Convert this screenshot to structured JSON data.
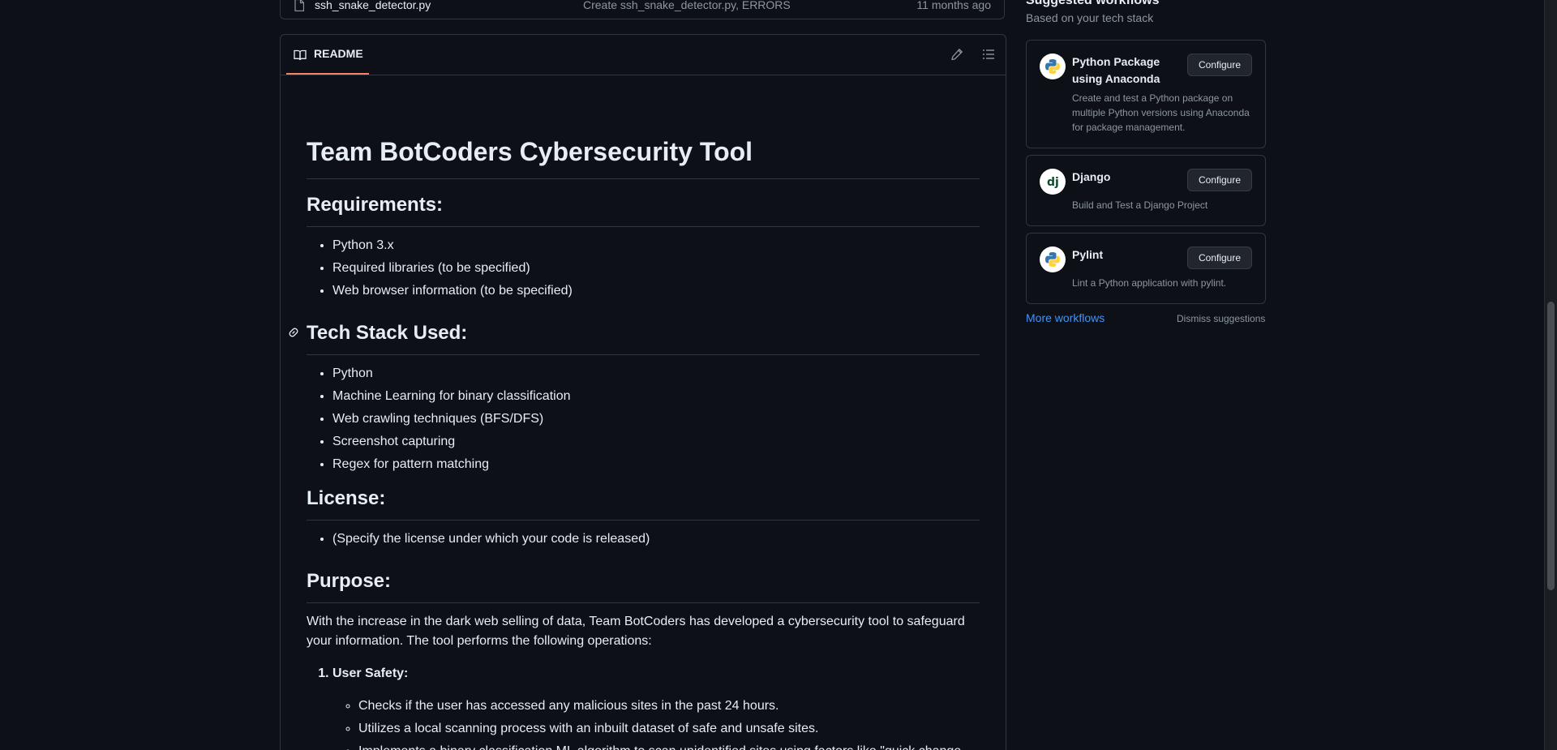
{
  "file_row": {
    "name": "ssh_snake_detector.py",
    "commit_message": "Create ssh_snake_detector.py, ERRORS",
    "age": "11 months ago"
  },
  "readme": {
    "tab_label": "README",
    "title": "Team BotCoders Cybersecurity Tool",
    "requirements": {
      "heading": "Requirements:",
      "items": [
        "Python 3.x",
        "Required libraries (to be specified)",
        "Web browser information (to be specified)"
      ]
    },
    "tech_stack": {
      "heading": "Tech Stack Used:",
      "items": [
        "Python",
        "Machine Learning for binary classification",
        "Web crawling techniques (BFS/DFS)",
        "Screenshot capturing",
        "Regex for pattern matching"
      ]
    },
    "license": {
      "heading": "License:",
      "items": [
        "(Specify the license under which your code is released)"
      ]
    },
    "purpose": {
      "heading": "Purpose:",
      "paragraph": "With the increase in the dark web selling of data, Team BotCoders has developed a cybersecurity tool to safeguard your information. The tool performs the following operations:",
      "ordered": [
        {
          "label": "User Safety:",
          "sub": [
            "Checks if the user has accessed any malicious sites in the past 24 hours.",
            "Utilizes a local scanning process with an inbuilt dataset of safe and unsafe sites.",
            "Implements a binary classification ML algorithm to scan unidentified sites using factors like \"quick change algorithm,\" suspicious regex, etc."
          ]
        }
      ]
    }
  },
  "sidebar": {
    "title": "Suggested workflows",
    "subtitle": "Based on your tech stack",
    "workflows": [
      {
        "name": "Python Package using Anaconda",
        "description": "Create and test a Python package on multiple Python versions using Anaconda for package management.",
        "button": "Configure",
        "icon": "python-logo"
      },
      {
        "name": "Django",
        "description": "Build and Test a Django Project",
        "button": "Configure",
        "icon": "django-logo"
      },
      {
        "name": "Pylint",
        "description": "Lint a Python application with pylint.",
        "button": "Configure",
        "icon": "python-logo"
      }
    ],
    "more_link": "More workflows",
    "dismiss": "Dismiss suggestions"
  },
  "colors": {
    "background": "#0d1117",
    "border": "#30363d",
    "accent_tab": "#f78166",
    "link": "#4493f8",
    "muted": "#8d96a0"
  }
}
